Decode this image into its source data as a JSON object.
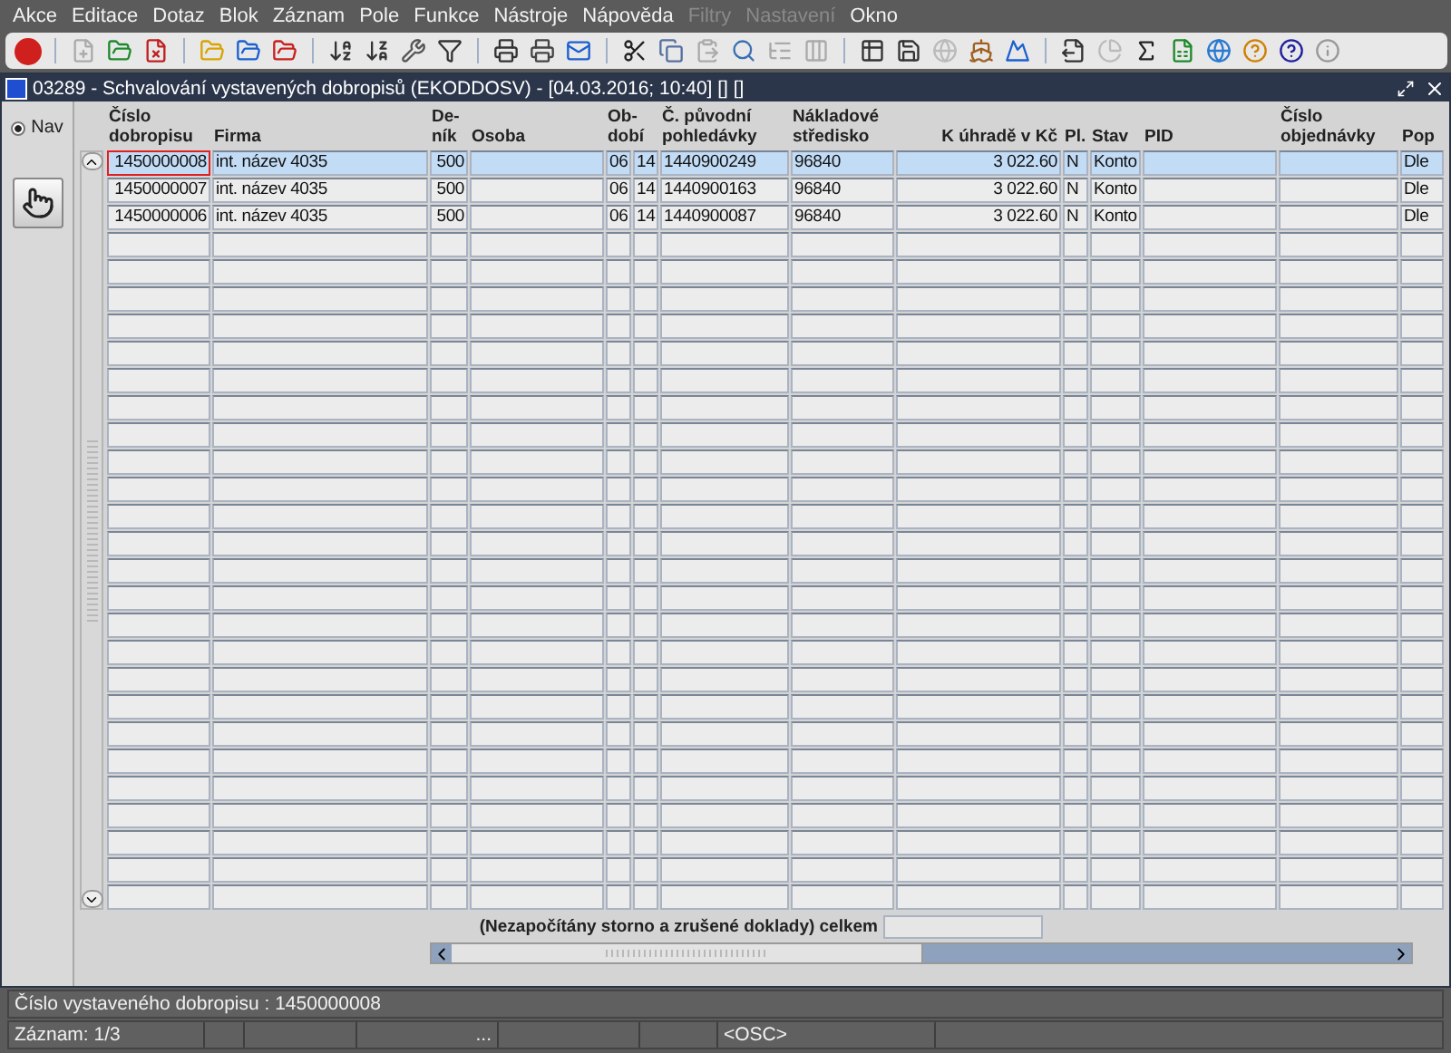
{
  "menu": [
    {
      "label": "Akce",
      "disabled": false
    },
    {
      "label": "Editace",
      "disabled": false
    },
    {
      "label": "Dotaz",
      "disabled": false
    },
    {
      "label": "Blok",
      "disabled": false
    },
    {
      "label": "Záznam",
      "disabled": false
    },
    {
      "label": "Pole",
      "disabled": false
    },
    {
      "label": "Funkce",
      "disabled": false
    },
    {
      "label": "Nástroje",
      "disabled": false
    },
    {
      "label": "Nápověda",
      "disabled": false
    },
    {
      "label": "Filtry",
      "disabled": true
    },
    {
      "label": "Nastavení",
      "disabled": true
    },
    {
      "label": "Okno",
      "disabled": false
    }
  ],
  "window": {
    "title": "03289 - Schvalování vystavených dobropisů (EKODDOSV) - [04.03.2016; 10:40] [] []"
  },
  "nav": {
    "label": "Nav",
    "selected": true
  },
  "columns": [
    "Číslo\ndobropisu",
    "Firma",
    "De-\nník",
    "Osoba",
    "Ob-\ndobí",
    "Č. původní\npohledávky",
    "Nákladové\nstředisko",
    "K úhradě v Kč",
    "Pl.",
    "Stav",
    "PID",
    "Číslo\nobjednávky",
    "Pop"
  ],
  "rows": [
    {
      "selected": true,
      "focused": true,
      "cells": [
        "1450000008",
        "int. název 4035",
        "500",
        null,
        [
          "06",
          "14"
        ],
        "1440900249",
        "96840",
        "3 022.60",
        "N",
        "Konto",
        null,
        null,
        "Dle"
      ]
    },
    {
      "selected": false,
      "focused": false,
      "cells": [
        "1450000007",
        "int. název 4035",
        "500",
        null,
        [
          "06",
          "14"
        ],
        "1440900163",
        "96840",
        "3 022.60",
        "N",
        "Konto",
        null,
        null,
        "Dle"
      ]
    },
    {
      "selected": false,
      "focused": false,
      "cells": [
        "1450000006",
        "int. název 4035",
        "500",
        null,
        [
          "06",
          "14"
        ],
        "1440900087",
        "96840",
        "3 022.60",
        "N",
        "Konto",
        null,
        null,
        "Dle"
      ]
    }
  ],
  "total_label": "(Nezapočítány storno a zrušené doklady) celkem",
  "hint": "Číslo vystaveného dobropisu : 1450000008",
  "status": {
    "record": "Záznam: 1/3",
    "segment_3": "...",
    "mode": "<OSC>"
  }
}
